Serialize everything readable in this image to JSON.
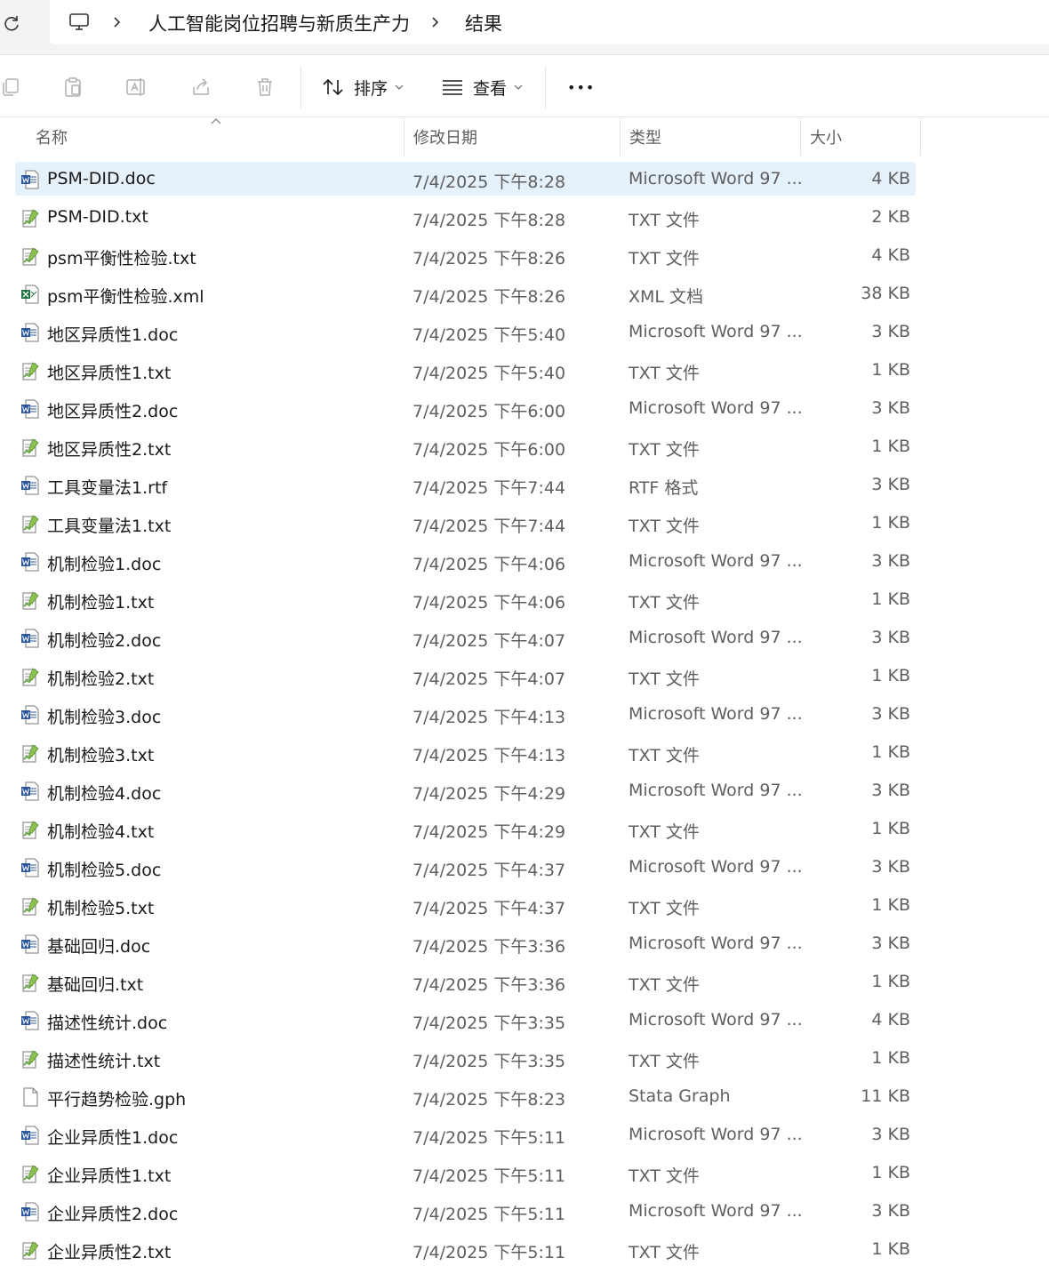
{
  "breadcrumb": {
    "items": [
      "人工智能岗位招聘与新质生产力",
      "结果"
    ]
  },
  "toolbar": {
    "sort_label": "排序",
    "view_label": "查看",
    "more_label": "•••"
  },
  "columns": {
    "name": "名称",
    "date": "修改日期",
    "type": "类型",
    "size": "大小"
  },
  "colors": {
    "selected_row": "#e5f1fb",
    "word_blue": "#2b579a",
    "excel_green": "#217346",
    "txt_green": "#6aa84f"
  },
  "files": [
    {
      "name": "PSM-DID.doc",
      "date": "7/4/2025 下午8:28",
      "type": "Microsoft Word 97 ...",
      "size": "4 KB",
      "icon": "word-doc-icon",
      "selected": true
    },
    {
      "name": "PSM-DID.txt",
      "date": "7/4/2025 下午8:28",
      "type": "TXT 文件",
      "size": "2 KB",
      "icon": "text-file-icon"
    },
    {
      "name": "psm平衡性检验.txt",
      "date": "7/4/2025 下午8:26",
      "type": "TXT 文件",
      "size": "4 KB",
      "icon": "text-file-icon"
    },
    {
      "name": "psm平衡性检验.xml",
      "date": "7/4/2025 下午8:26",
      "type": "XML 文档",
      "size": "38 KB",
      "icon": "excel-xml-icon"
    },
    {
      "name": "地区异质性1.doc",
      "date": "7/4/2025 下午5:40",
      "type": "Microsoft Word 97 ...",
      "size": "3 KB",
      "icon": "word-doc-icon"
    },
    {
      "name": "地区异质性1.txt",
      "date": "7/4/2025 下午5:40",
      "type": "TXT 文件",
      "size": "1 KB",
      "icon": "text-file-icon"
    },
    {
      "name": "地区异质性2.doc",
      "date": "7/4/2025 下午6:00",
      "type": "Microsoft Word 97 ...",
      "size": "3 KB",
      "icon": "word-doc-icon"
    },
    {
      "name": "地区异质性2.txt",
      "date": "7/4/2025 下午6:00",
      "type": "TXT 文件",
      "size": "1 KB",
      "icon": "text-file-icon"
    },
    {
      "name": "工具变量法1.rtf",
      "date": "7/4/2025 下午7:44",
      "type": "RTF 格式",
      "size": "3 KB",
      "icon": "word-doc-icon"
    },
    {
      "name": "工具变量法1.txt",
      "date": "7/4/2025 下午7:44",
      "type": "TXT 文件",
      "size": "1 KB",
      "icon": "text-file-icon"
    },
    {
      "name": "机制检验1.doc",
      "date": "7/4/2025 下午4:06",
      "type": "Microsoft Word 97 ...",
      "size": "3 KB",
      "icon": "word-doc-icon"
    },
    {
      "name": "机制检验1.txt",
      "date": "7/4/2025 下午4:06",
      "type": "TXT 文件",
      "size": "1 KB",
      "icon": "text-file-icon"
    },
    {
      "name": "机制检验2.doc",
      "date": "7/4/2025 下午4:07",
      "type": "Microsoft Word 97 ...",
      "size": "3 KB",
      "icon": "word-doc-icon"
    },
    {
      "name": "机制检验2.txt",
      "date": "7/4/2025 下午4:07",
      "type": "TXT 文件",
      "size": "1 KB",
      "icon": "text-file-icon"
    },
    {
      "name": "机制检验3.doc",
      "date": "7/4/2025 下午4:13",
      "type": "Microsoft Word 97 ...",
      "size": "3 KB",
      "icon": "word-doc-icon"
    },
    {
      "name": "机制检验3.txt",
      "date": "7/4/2025 下午4:13",
      "type": "TXT 文件",
      "size": "1 KB",
      "icon": "text-file-icon"
    },
    {
      "name": "机制检验4.doc",
      "date": "7/4/2025 下午4:29",
      "type": "Microsoft Word 97 ...",
      "size": "3 KB",
      "icon": "word-doc-icon"
    },
    {
      "name": "机制检验4.txt",
      "date": "7/4/2025 下午4:29",
      "type": "TXT 文件",
      "size": "1 KB",
      "icon": "text-file-icon"
    },
    {
      "name": "机制检验5.doc",
      "date": "7/4/2025 下午4:37",
      "type": "Microsoft Word 97 ...",
      "size": "3 KB",
      "icon": "word-doc-icon"
    },
    {
      "name": "机制检验5.txt",
      "date": "7/4/2025 下午4:37",
      "type": "TXT 文件",
      "size": "1 KB",
      "icon": "text-file-icon"
    },
    {
      "name": "基础回归.doc",
      "date": "7/4/2025 下午3:36",
      "type": "Microsoft Word 97 ...",
      "size": "3 KB",
      "icon": "word-doc-icon"
    },
    {
      "name": "基础回归.txt",
      "date": "7/4/2025 下午3:36",
      "type": "TXT 文件",
      "size": "1 KB",
      "icon": "text-file-icon"
    },
    {
      "name": "描述性统计.doc",
      "date": "7/4/2025 下午3:35",
      "type": "Microsoft Word 97 ...",
      "size": "4 KB",
      "icon": "word-doc-icon"
    },
    {
      "name": "描述性统计.txt",
      "date": "7/4/2025 下午3:35",
      "type": "TXT 文件",
      "size": "1 KB",
      "icon": "text-file-icon"
    },
    {
      "name": "平行趋势检验.gph",
      "date": "7/4/2025 下午8:23",
      "type": "Stata Graph",
      "size": "11 KB",
      "icon": "blank-file-icon"
    },
    {
      "name": "企业异质性1.doc",
      "date": "7/4/2025 下午5:11",
      "type": "Microsoft Word 97 ...",
      "size": "3 KB",
      "icon": "word-doc-icon"
    },
    {
      "name": "企业异质性1.txt",
      "date": "7/4/2025 下午5:11",
      "type": "TXT 文件",
      "size": "1 KB",
      "icon": "text-file-icon"
    },
    {
      "name": "企业异质性2.doc",
      "date": "7/4/2025 下午5:11",
      "type": "Microsoft Word 97 ...",
      "size": "3 KB",
      "icon": "word-doc-icon"
    },
    {
      "name": "企业异质性2.txt",
      "date": "7/4/2025 下午5:11",
      "type": "TXT 文件",
      "size": "1 KB",
      "icon": "text-file-icon"
    }
  ]
}
